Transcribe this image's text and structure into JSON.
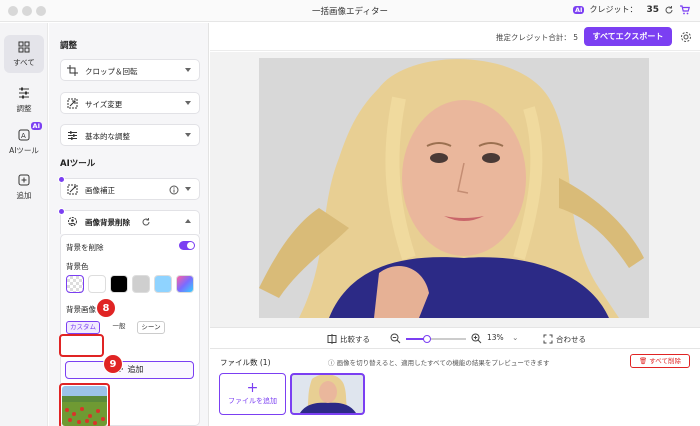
{
  "window": {
    "title": "一括画像エディター"
  },
  "credits": {
    "ai_badge": "AI",
    "label": "クレジット：",
    "value": "35"
  },
  "rail": [
    {
      "label": "すべて",
      "icon": "grid-icon"
    },
    {
      "label": "調整",
      "icon": "sliders-icon"
    },
    {
      "label": "AIツール",
      "icon": "ai-tools-icon",
      "badge": "AI"
    },
    {
      "label": "追加",
      "icon": "plus-box-icon"
    }
  ],
  "panel": {
    "section_adjust": "調整",
    "adjust_items": [
      {
        "label": "クロップ＆回転",
        "icon": "crop-icon"
      },
      {
        "label": "サイズ変更",
        "icon": "resize-icon"
      },
      {
        "label": "基本的な調整",
        "icon": "sliders-icon"
      }
    ],
    "section_ai": "AIツール",
    "ai_items": [
      {
        "label": "画像補正",
        "icon": "enhance-icon"
      },
      {
        "label": "画像背景削除",
        "icon": "bg-remove-icon"
      }
    ],
    "bg": {
      "remove_label": "背景を削除",
      "remove_on": true,
      "color_label": "背景色",
      "colors": [
        "transparent",
        "#ffffff",
        "#000000",
        "#cfcfcf",
        "#8fd3ff",
        "gradient"
      ],
      "image_label": "背景画像",
      "tabs": [
        "カスタム",
        "一般",
        "シーン"
      ],
      "selected_tab": "カスタム",
      "add_label": "追加"
    },
    "steps": [
      "8",
      "9"
    ]
  },
  "main": {
    "estimate_label": "推定クレジット合計：",
    "estimate_value": "5",
    "export_label": "すべてエクスポート",
    "compare_label": "比較する",
    "zoom_value": "13%",
    "fit_label": "合わせる",
    "zoom_level": 0.35,
    "file_count_label": "ファイル数 (1)",
    "hint": "画像を切り替えると、適用したすべての機能の結果をプレビューできます",
    "delete_all": "すべて削除",
    "add_file": "ファイルを追加"
  }
}
